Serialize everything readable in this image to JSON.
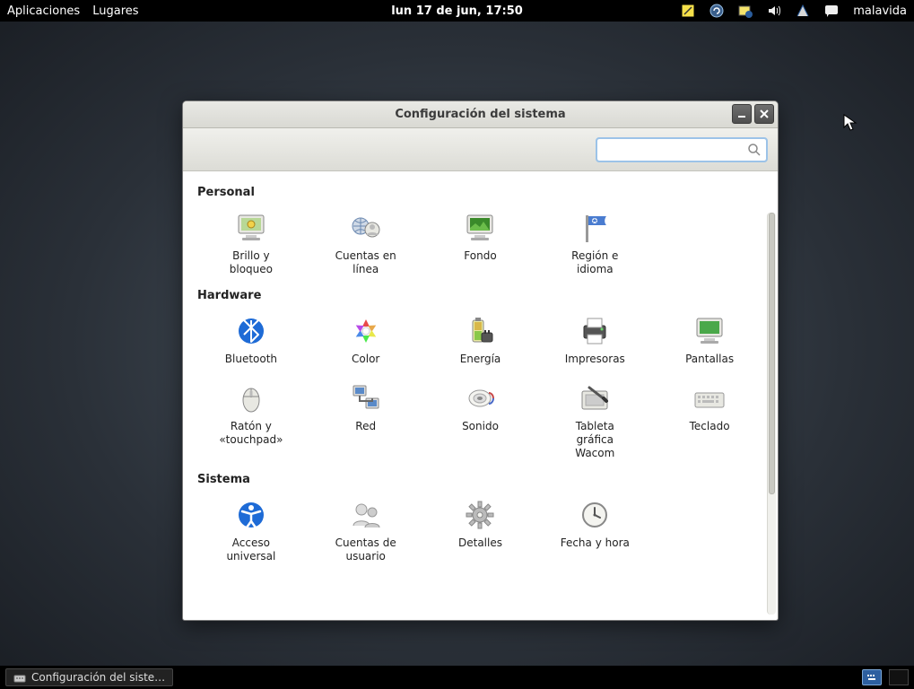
{
  "topbar": {
    "applications": "Aplicaciones",
    "places": "Lugares",
    "clock": "lun 17 de jun, 17:50",
    "username": "malavida"
  },
  "window": {
    "title": "Configuración del sistema",
    "search_placeholder": ""
  },
  "sections": {
    "personal": {
      "title": "Personal",
      "items": [
        {
          "name": "brightness-lock",
          "label": "Brillo y\nbloqueo"
        },
        {
          "name": "online-accounts",
          "label": "Cuentas en\nlínea"
        },
        {
          "name": "background",
          "label": "Fondo"
        },
        {
          "name": "region-language",
          "label": "Región e\nidioma"
        }
      ]
    },
    "hardware": {
      "title": "Hardware",
      "items": [
        {
          "name": "bluetooth",
          "label": "Bluetooth"
        },
        {
          "name": "color",
          "label": "Color"
        },
        {
          "name": "power",
          "label": "Energía"
        },
        {
          "name": "printers",
          "label": "Impresoras"
        },
        {
          "name": "displays",
          "label": "Pantallas"
        },
        {
          "name": "mouse-touchpad",
          "label": "Ratón y\n«touchpad»"
        },
        {
          "name": "network",
          "label": "Red"
        },
        {
          "name": "sound",
          "label": "Sonido"
        },
        {
          "name": "wacom",
          "label": "Tableta\ngráfica\nWacom"
        },
        {
          "name": "keyboard",
          "label": "Teclado"
        }
      ]
    },
    "system": {
      "title": "Sistema",
      "items": [
        {
          "name": "universal-access",
          "label": "Acceso\nuniversal"
        },
        {
          "name": "user-accounts",
          "label": "Cuentas de\nusuario"
        },
        {
          "name": "details",
          "label": "Detalles"
        },
        {
          "name": "date-time",
          "label": "Fecha y hora"
        }
      ]
    }
  },
  "taskbar": {
    "active_task": "Configuración del siste…"
  }
}
